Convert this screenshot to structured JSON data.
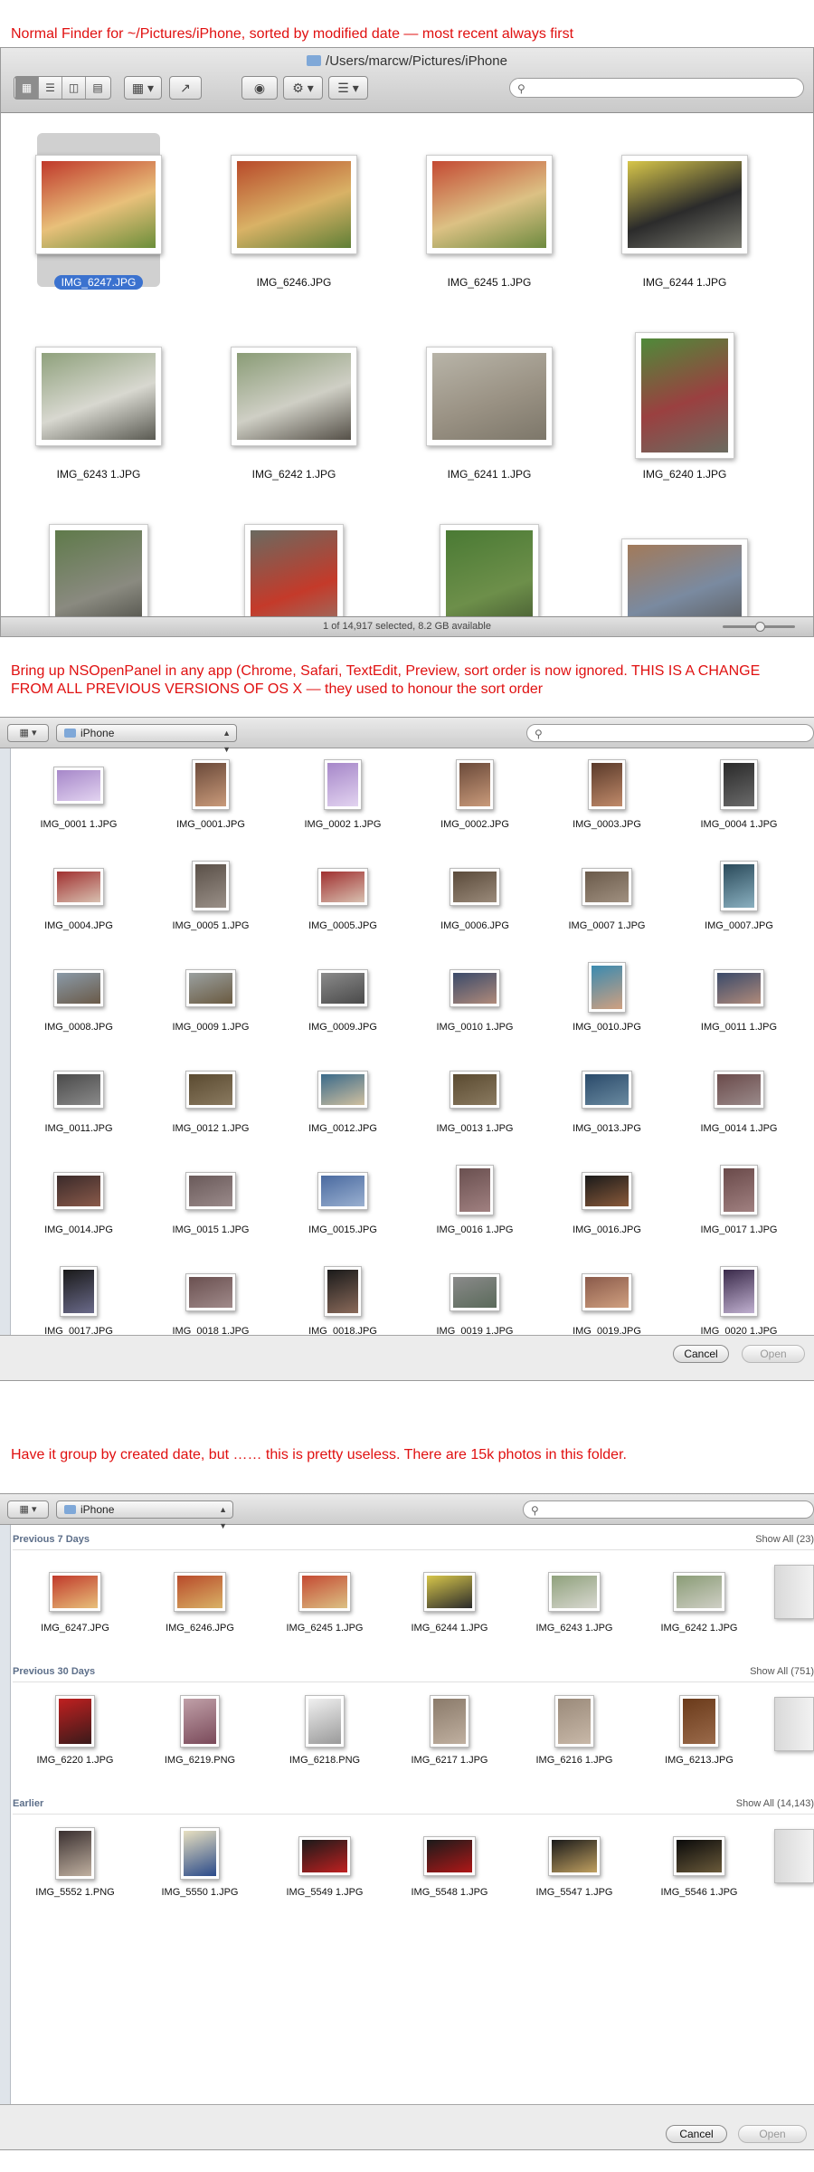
{
  "captions": {
    "c1": "Normal Finder for ~/Pictures/iPhone, sorted by modified date — most recent always first",
    "c2": "Bring up NSOpenPanel in any app (Chrome, Safari, TextEdit, Preview, sort order is now ignored. THIS IS A CHANGE FROM ALL PREVIOUS VERSIONS OF OS X — they used to honour the sort order",
    "c3": "Have it group by created date, but …… this is pretty useless.  There are 15k photos in this folder."
  },
  "finder": {
    "title": "/Users/marcw/Pictures/iPhone",
    "status": "1 of 14,917 selected, 8.2 GB available",
    "toolbar_icons": [
      "icon-view-icon",
      "list-view-icon",
      "column-view-icon",
      "coverflow-view-icon",
      "arrange-icon",
      "share-icon",
      "quicklook-eye-icon",
      "gear-icon",
      "arrange-by-icon"
    ],
    "items": [
      {
        "name": "IMG_6247.JPG",
        "selected": true,
        "colors": [
          "#c0392b",
          "#e8c07a",
          "#6b8e3a"
        ],
        "shape": "landscape"
      },
      {
        "name": "IMG_6246.JPG",
        "selected": false,
        "colors": [
          "#b84a2a",
          "#d9b266",
          "#5f7f36"
        ],
        "shape": "landscape"
      },
      {
        "name": "IMG_6245 1.JPG",
        "selected": false,
        "colors": [
          "#c44a33",
          "#dcc184",
          "#6d8a3f"
        ],
        "shape": "landscape"
      },
      {
        "name": "IMG_6244 1.JPG",
        "selected": false,
        "colors": [
          "#d7c64a",
          "#2b2b2b",
          "#7a7a70"
        ],
        "shape": "landscape"
      },
      {
        "name": "IMG_6243 1.JPG",
        "selected": false,
        "colors": [
          "#8fa17c",
          "#d8d8d0",
          "#5a5a52"
        ],
        "shape": "landscape"
      },
      {
        "name": "IMG_6242 1.JPG",
        "selected": false,
        "colors": [
          "#8a9c76",
          "#cfcfc5",
          "#555048"
        ],
        "shape": "landscape"
      },
      {
        "name": "IMG_6241 1.JPG",
        "selected": false,
        "colors": [
          "#b8b4a8",
          "#9a9284",
          "#7d776a"
        ],
        "shape": "landscape"
      },
      {
        "name": "IMG_6240 1.JPG",
        "selected": false,
        "colors": [
          "#4f8a3a",
          "#9a4040",
          "#6b6b60"
        ],
        "shape": "portrait"
      },
      {
        "name": "",
        "selected": false,
        "colors": [
          "#5f7a4a",
          "#8a8a80",
          "#3a3a34"
        ],
        "shape": "portrait"
      },
      {
        "name": "",
        "selected": false,
        "colors": [
          "#6a6a60",
          "#c43a2a",
          "#8a8478"
        ],
        "shape": "portrait"
      },
      {
        "name": "",
        "selected": false,
        "colors": [
          "#4a7a34",
          "#6d8f4a",
          "#3a4a2a"
        ],
        "shape": "portrait"
      },
      {
        "name": "",
        "selected": false,
        "colors": [
          "#a27a5a",
          "#7a8aa0",
          "#5a5a5a"
        ],
        "shape": "landscape"
      }
    ]
  },
  "openpanel1": {
    "folder": "iPhone",
    "cancel": "Cancel",
    "open": "Open",
    "items": [
      {
        "name": "IMG_0001 1.JPG",
        "colors": [
          "#a687c9",
          "#e2d3f0"
        ],
        "shape": "landscape"
      },
      {
        "name": "IMG_0001.JPG",
        "colors": [
          "#6b4a3a",
          "#c99a7a"
        ],
        "shape": "portrait"
      },
      {
        "name": "IMG_0002 1.JPG",
        "colors": [
          "#a687c9",
          "#e2d3f0"
        ],
        "shape": "portrait"
      },
      {
        "name": "IMG_0002.JPG",
        "colors": [
          "#6b4a3a",
          "#c99a7a"
        ],
        "shape": "portrait"
      },
      {
        "name": "IMG_0003.JPG",
        "colors": [
          "#5a3a2a",
          "#c08a6a"
        ],
        "shape": "portrait"
      },
      {
        "name": "IMG_0004 1.JPG",
        "colors": [
          "#2a2a2a",
          "#6a6a6a"
        ],
        "shape": "portrait"
      },
      {
        "name": "IMG_0004.JPG",
        "colors": [
          "#a03030",
          "#d8c0b0"
        ],
        "shape": "landscape"
      },
      {
        "name": "IMG_0005 1.JPG",
        "colors": [
          "#5a5048",
          "#9a9088"
        ],
        "shape": "portrait"
      },
      {
        "name": "IMG_0005.JPG",
        "colors": [
          "#a03030",
          "#d8c0b0"
        ],
        "shape": "landscape"
      },
      {
        "name": "IMG_0006.JPG",
        "colors": [
          "#5a4a3a",
          "#9a8a7a"
        ],
        "shape": "landscape"
      },
      {
        "name": "IMG_0007 1.JPG",
        "colors": [
          "#6a5a4a",
          "#a09080"
        ],
        "shape": "landscape"
      },
      {
        "name": "IMG_0007.JPG",
        "colors": [
          "#2a4a5a",
          "#8ab0c0"
        ],
        "shape": "portrait"
      },
      {
        "name": "IMG_0008.JPG",
        "colors": [
          "#8a9aa8",
          "#6a5a48"
        ],
        "shape": "landscape"
      },
      {
        "name": "IMG_0009 1.JPG",
        "colors": [
          "#9aa0a0",
          "#6a5a40"
        ],
        "shape": "landscape"
      },
      {
        "name": "IMG_0009.JPG",
        "colors": [
          "#8a8a8a",
          "#4a4a4a"
        ],
        "shape": "landscape"
      },
      {
        "name": "IMG_0010 1.JPG",
        "colors": [
          "#3a4a6a",
          "#b08a7a"
        ],
        "shape": "landscape"
      },
      {
        "name": "IMG_0010.JPG",
        "colors": [
          "#3a8ab0",
          "#d0a080"
        ],
        "shape": "portrait"
      },
      {
        "name": "IMG_0011 1.JPG",
        "colors": [
          "#3a4a6a",
          "#b08a7a"
        ],
        "shape": "landscape"
      },
      {
        "name": "IMG_0011.JPG",
        "colors": [
          "#4a4a4a",
          "#8a8a8a"
        ],
        "shape": "landscape"
      },
      {
        "name": "IMG_0012 1.JPG",
        "colors": [
          "#5a4a30",
          "#8a7a60"
        ],
        "shape": "landscape"
      },
      {
        "name": "IMG_0012.JPG",
        "colors": [
          "#3a6a8a",
          "#d0c0a0"
        ],
        "shape": "landscape"
      },
      {
        "name": "IMG_0013 1.JPG",
        "colors": [
          "#5a4a30",
          "#8a7a60"
        ],
        "shape": "landscape"
      },
      {
        "name": "IMG_0013.JPG",
        "colors": [
          "#2a4a6a",
          "#6a8aa0"
        ],
        "shape": "landscape"
      },
      {
        "name": "IMG_0014 1.JPG",
        "colors": [
          "#6a4a4a",
          "#9a8a8a"
        ],
        "shape": "landscape"
      },
      {
        "name": "IMG_0014.JPG",
        "colors": [
          "#3a2a2a",
          "#8a5a4a"
        ],
        "shape": "landscape"
      },
      {
        "name": "IMG_0015 1.JPG",
        "colors": [
          "#6a5a5a",
          "#9a8a8a"
        ],
        "shape": "landscape"
      },
      {
        "name": "IMG_0015.JPG",
        "colors": [
          "#4a6aa0",
          "#9ab0d0"
        ],
        "shape": "landscape"
      },
      {
        "name": "IMG_0016 1.JPG",
        "colors": [
          "#6a5050",
          "#a08080"
        ],
        "shape": "portrait"
      },
      {
        "name": "IMG_0016.JPG",
        "colors": [
          "#1a1a1a",
          "#8a5a3a"
        ],
        "shape": "landscape"
      },
      {
        "name": "IMG_0017 1.JPG",
        "colors": [
          "#6a4a4a",
          "#a08080"
        ],
        "shape": "portrait"
      },
      {
        "name": "IMG_0017.JPG",
        "colors": [
          "#1a1a1a",
          "#6a6a8a"
        ],
        "shape": "portrait"
      },
      {
        "name": "IMG_0018 1.JPG",
        "colors": [
          "#6a5050",
          "#a08a8a"
        ],
        "shape": "landscape"
      },
      {
        "name": "IMG_0018.JPG",
        "colors": [
          "#1a1a1a",
          "#8a6a5a"
        ],
        "shape": "portrait"
      },
      {
        "name": "IMG_0019 1.JPG",
        "colors": [
          "#8a8a8a",
          "#5a6a5a"
        ],
        "shape": "landscape"
      },
      {
        "name": "IMG_0019.JPG",
        "colors": [
          "#8a5a4a",
          "#d0a080"
        ],
        "shape": "landscape"
      },
      {
        "name": "IMG_0020 1.JPG",
        "colors": [
          "#3a2a4a",
          "#c0b0d0"
        ],
        "shape": "portrait"
      }
    ]
  },
  "openpanel2": {
    "folder": "iPhone",
    "cancel": "Cancel",
    "open": "Open",
    "groups": [
      {
        "title": "Previous 7 Days",
        "show_all": "Show All (23)",
        "items": [
          {
            "name": "IMG_6247.JPG",
            "colors": [
              "#c0392b",
              "#e8c07a"
            ],
            "shape": "landscape"
          },
          {
            "name": "IMG_6246.JPG",
            "colors": [
              "#b84a2a",
              "#d9b266"
            ],
            "shape": "landscape"
          },
          {
            "name": "IMG_6245 1.JPG",
            "colors": [
              "#c44a33",
              "#dcc184"
            ],
            "shape": "landscape"
          },
          {
            "name": "IMG_6244 1.JPG",
            "colors": [
              "#d7c64a",
              "#2b2b2b"
            ],
            "shape": "landscape"
          },
          {
            "name": "IMG_6243 1.JPG",
            "colors": [
              "#8fa17c",
              "#d8d8d0"
            ],
            "shape": "landscape"
          },
          {
            "name": "IMG_6242 1.JPG",
            "colors": [
              "#8a9c76",
              "#cfcfc5"
            ],
            "shape": "landscape"
          }
        ]
      },
      {
        "title": "Previous 30 Days",
        "show_all": "Show All (751)",
        "items": [
          {
            "name": "IMG_6220 1.JPG",
            "colors": [
              "#c02020",
              "#3a1a1a"
            ],
            "shape": "portrait"
          },
          {
            "name": "IMG_6219.PNG",
            "colors": [
              "#c0a0a8",
              "#7a4a5a"
            ],
            "shape": "portrait"
          },
          {
            "name": "IMG_6218.PNG",
            "colors": [
              "#f0f0f0",
              "#9a9a9a"
            ],
            "shape": "portrait"
          },
          {
            "name": "IMG_6217 1.JPG",
            "colors": [
              "#8a7a6a",
              "#c0b0a0"
            ],
            "shape": "portrait"
          },
          {
            "name": "IMG_6216 1.JPG",
            "colors": [
              "#9a8a7a",
              "#c8b8a8"
            ],
            "shape": "portrait"
          },
          {
            "name": "IMG_6213.JPG",
            "colors": [
              "#6a3a1a",
              "#9a6a4a"
            ],
            "shape": "portrait"
          }
        ]
      },
      {
        "title": "Earlier",
        "show_all": "Show All (14,143)",
        "items": [
          {
            "name": "IMG_5552 1.PNG",
            "colors": [
              "#3a3030",
              "#c0b0a0"
            ],
            "shape": "portrait"
          },
          {
            "name": "IMG_5550 1.JPG",
            "colors": [
              "#e8e0c0",
              "#2a4a8a"
            ],
            "shape": "portrait"
          },
          {
            "name": "IMG_5549 1.JPG",
            "colors": [
              "#1a1a1a",
              "#c02020"
            ],
            "shape": "landscape"
          },
          {
            "name": "IMG_5548 1.JPG",
            "colors": [
              "#1a1a1a",
              "#b01818"
            ],
            "shape": "landscape"
          },
          {
            "name": "IMG_5547 1.JPG",
            "colors": [
              "#1a1a1a",
              "#c0a060"
            ],
            "shape": "landscape"
          },
          {
            "name": "IMG_5546 1.JPG",
            "colors": [
              "#0a0a0a",
              "#6a5a3a"
            ],
            "shape": "landscape"
          }
        ]
      }
    ]
  }
}
